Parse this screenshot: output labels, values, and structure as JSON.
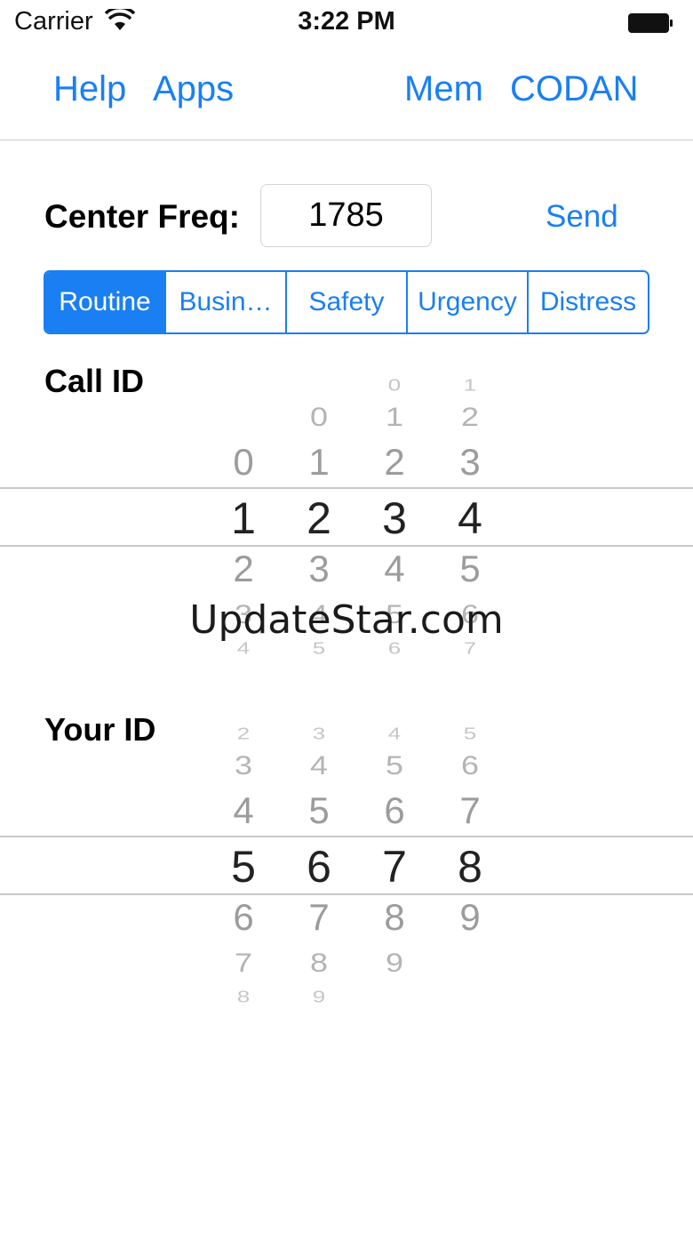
{
  "status_bar": {
    "carrier": "Carrier",
    "time": "3:22 PM",
    "wifi_icon": "wifi-icon",
    "battery_icon": "battery-full-icon"
  },
  "nav": {
    "help": "Help",
    "apps": "Apps",
    "mem": "Mem",
    "codan": "CODAN"
  },
  "frequency": {
    "label": "Center Freq:",
    "value": "1785",
    "send_label": "Send"
  },
  "call_type": {
    "options": [
      "Routine",
      "Busin…",
      "Safety",
      "Urgency",
      "Distress"
    ],
    "selected": "Routine"
  },
  "call_id": {
    "label": "Call ID",
    "wheels": [
      [
        "",
        "",
        "0",
        "1",
        "2",
        "3",
        "4"
      ],
      [
        "",
        "0",
        "1",
        "2",
        "3",
        "4",
        "5"
      ],
      [
        "0",
        "1",
        "2",
        "3",
        "4",
        "5",
        "6"
      ],
      [
        "1",
        "2",
        "3",
        "4",
        "5",
        "6",
        "7"
      ]
    ]
  },
  "your_id": {
    "label": "Your ID",
    "wheels": [
      [
        "2",
        "3",
        "4",
        "5",
        "6",
        "7",
        "8"
      ],
      [
        "3",
        "4",
        "5",
        "6",
        "7",
        "8",
        "9"
      ],
      [
        "4",
        "5",
        "6",
        "7",
        "8",
        "9",
        ""
      ],
      [
        "5",
        "6",
        "7",
        "8",
        "9",
        "",
        ""
      ]
    ]
  },
  "colors": {
    "accent": "#1a7ff3",
    "divider": "#c8c8cc"
  },
  "watermark": "UpdateStar.com"
}
